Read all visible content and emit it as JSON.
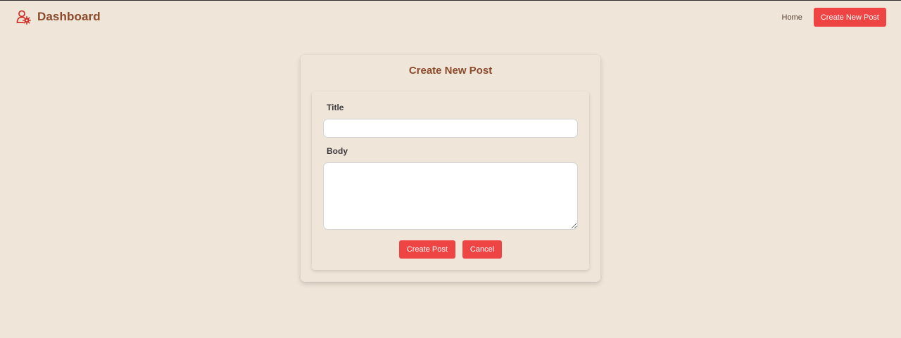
{
  "header": {
    "brand": "Dashboard",
    "brand_icon": "user-settings-icon",
    "nav_home": "Home",
    "nav_create": "Create New Post"
  },
  "form": {
    "heading": "Create New Post",
    "title_label": "Title",
    "title_value": "",
    "title_placeholder": "",
    "body_label": "Body",
    "body_value": "",
    "body_placeholder": "",
    "submit_label": "Create Post",
    "cancel_label": "Cancel"
  },
  "colors": {
    "background": "#efe5d8",
    "brand": "#8a4a2b",
    "accent": "#ef4444"
  }
}
